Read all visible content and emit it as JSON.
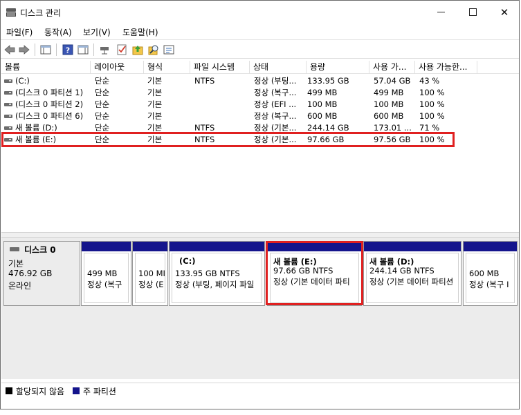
{
  "window": {
    "title": "디스크 관리"
  },
  "menu": [
    "파일(F)",
    "동작(A)",
    "보기(V)",
    "도움말(H)"
  ],
  "toolbar": {
    "icons": [
      "back-arrow-icon",
      "forward-arrow-icon",
      "console-tree-icon",
      "help-icon",
      "action-pane-icon",
      "connect-icon",
      "checklist-icon",
      "folder-up-icon",
      "search-icon",
      "properties-icon"
    ]
  },
  "columns": [
    "볼륨",
    "레이아웃",
    "형식",
    "파일 시스템",
    "상태",
    "용량",
    "사용 가...",
    "사용 가능한..."
  ],
  "volumes": [
    {
      "name": "(C:)",
      "layout": "단순",
      "type": "기본",
      "fs": "NTFS",
      "status": "정상 (부팅...",
      "capacity": "133.95 GB",
      "free": "57.04 GB",
      "pct": "43 %"
    },
    {
      "name": "(디스크 0 파티션 1)",
      "layout": "단순",
      "type": "기본",
      "fs": "",
      "status": "정상 (복구...",
      "capacity": "499 MB",
      "free": "499 MB",
      "pct": "100 %"
    },
    {
      "name": "(디스크 0 파티션 2)",
      "layout": "단순",
      "type": "기본",
      "fs": "",
      "status": "정상 (EFI ...",
      "capacity": "100 MB",
      "free": "100 MB",
      "pct": "100 %"
    },
    {
      "name": "(디스크 0 파티션 6)",
      "layout": "단순",
      "type": "기본",
      "fs": "",
      "status": "정상 (복구...",
      "capacity": "600 MB",
      "free": "600 MB",
      "pct": "100 %"
    },
    {
      "name": "새 볼륨 (D:)",
      "layout": "단순",
      "type": "기본",
      "fs": "NTFS",
      "status": "정상 (기본...",
      "capacity": "244.14 GB",
      "free": "173.01 ...",
      "pct": "71 %"
    },
    {
      "name": "새 볼륨 (E:)",
      "layout": "단순",
      "type": "기본",
      "fs": "NTFS",
      "status": "정상 (기본...",
      "capacity": "97.66 GB",
      "free": "97.56 GB",
      "pct": "100 %"
    }
  ],
  "disk": {
    "name": "디스크 0",
    "type": "기본",
    "size": "476.92 GB",
    "state": "온라인"
  },
  "partitions": [
    {
      "title": "",
      "line1": "499 MB",
      "line2": "정상 (복구"
    },
    {
      "title": "",
      "line1": "100 MI",
      "line2": "정상 (E"
    },
    {
      "title": "(C:)",
      "line1": "133.95 GB NTFS",
      "line2": "정상 (부팅, 페이지 파일"
    },
    {
      "title": "새 볼륨  (E:)",
      "line1": "97.66 GB NTFS",
      "line2": "정상 (기본 데이터 파티"
    },
    {
      "title": "새 볼륨  (D:)",
      "line1": "244.14 GB NTFS",
      "line2": "정상 (기본 데이터 파티션"
    },
    {
      "title": "",
      "line1": "600 MB",
      "line2": "정상 (복구 I"
    }
  ],
  "legend": [
    {
      "label": "할당되지 않음",
      "color": "#000000"
    },
    {
      "label": "주 파티션",
      "color": "#14148c"
    }
  ],
  "colors": {
    "partition_bar": "#14148c",
    "highlight": "#e02020"
  }
}
